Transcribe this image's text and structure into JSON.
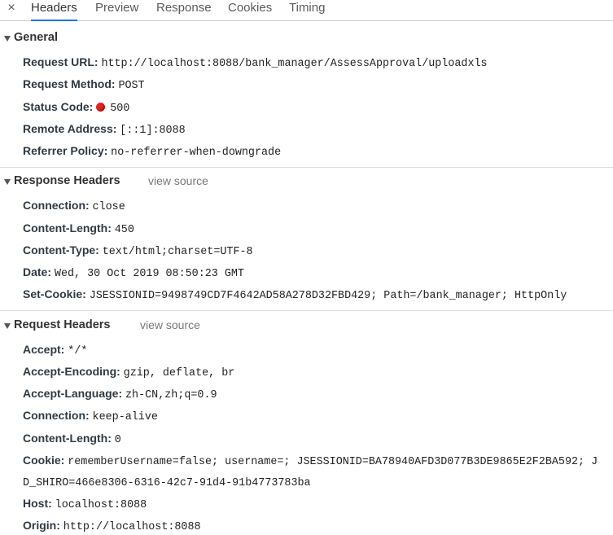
{
  "tabs": [
    "Headers",
    "Preview",
    "Response",
    "Cookies",
    "Timing"
  ],
  "close_glyph": "×",
  "general": {
    "title": "General",
    "request_url": {
      "key": "Request URL:",
      "value": "http://localhost:8088/bank_manager/AssessApproval/uploadxls"
    },
    "request_method": {
      "key": "Request Method:",
      "value": "POST"
    },
    "status_code": {
      "key": "Status Code:",
      "value": "500",
      "status_color": "#e52222"
    },
    "remote_address": {
      "key": "Remote Address:",
      "value": "[::1]:8088"
    },
    "referrer_policy": {
      "key": "Referrer Policy:",
      "value": "no-referrer-when-downgrade"
    }
  },
  "response_headers": {
    "title": "Response Headers",
    "view_source": "view source",
    "items": [
      {
        "key": "Connection:",
        "value": "close"
      },
      {
        "key": "Content-Length:",
        "value": "450"
      },
      {
        "key": "Content-Type:",
        "value": "text/html;charset=UTF-8"
      },
      {
        "key": "Date:",
        "value": "Wed, 30 Oct 2019 08:50:23 GMT"
      },
      {
        "key": "Set-Cookie:",
        "value": "JSESSIONID=9498749CD7F4642AD58A278D32FBD429; Path=/bank_manager; HttpOnly"
      }
    ]
  },
  "request_headers": {
    "title": "Request Headers",
    "view_source": "view source",
    "items": [
      {
        "key": "Accept:",
        "value": "*/*"
      },
      {
        "key": "Accept-Encoding:",
        "value": "gzip, deflate, br"
      },
      {
        "key": "Accept-Language:",
        "value": "zh-CN,zh;q=0.9"
      },
      {
        "key": "Connection:",
        "value": "keep-alive"
      },
      {
        "key": "Content-Length:",
        "value": "0"
      },
      {
        "key": "Cookie:",
        "value": "rememberUsername=false; username=; JSESSIONID=BA78940AFD3D077B3DE9865E2F2BA592; J",
        "continuation": "D_SHIRO=466e8306-6316-42c7-91d4-91b4773783ba"
      },
      {
        "key": "Host:",
        "value": "localhost:8088"
      },
      {
        "key": "Origin:",
        "value": "http://localhost:8088"
      }
    ]
  }
}
